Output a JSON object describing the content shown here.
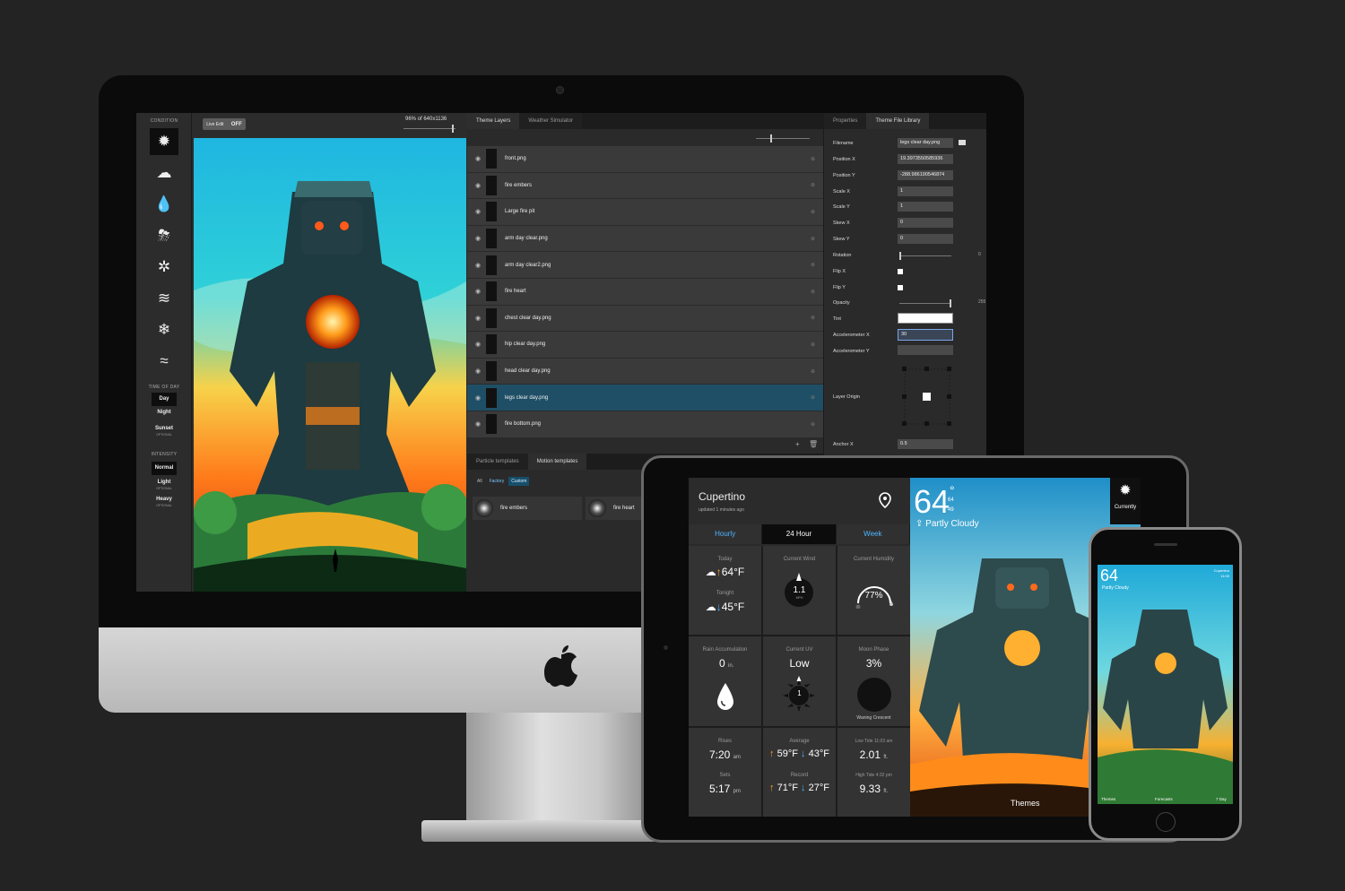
{
  "editor": {
    "condition_header": "CONDITION",
    "conditions": [
      {
        "icon": "sun-icon",
        "glyph": "✹",
        "selected": true
      },
      {
        "icon": "cloud-icon",
        "glyph": "☁",
        "selected": false
      },
      {
        "icon": "raindrop-icon",
        "glyph": "💧",
        "selected": false
      },
      {
        "icon": "thunder-cloud-icon",
        "glyph": "⛈",
        "selected": false
      },
      {
        "icon": "sun-cloud-icon",
        "glyph": "✲",
        "selected": false
      },
      {
        "icon": "fog-icon",
        "glyph": "≋",
        "selected": false
      },
      {
        "icon": "snowflake-icon",
        "glyph": "❄",
        "selected": false
      },
      {
        "icon": "wind-icon",
        "glyph": "≈",
        "selected": false
      }
    ],
    "time_header": "TIME OF DAY",
    "time_options": [
      {
        "label": "Day",
        "sub": "",
        "selected": true
      },
      {
        "label": "Night",
        "sub": "",
        "selected": false
      },
      {
        "label": "Sunset",
        "sub": "OPTIONAL",
        "selected": false
      }
    ],
    "intensity_header": "INTENSITY",
    "intensity_options": [
      {
        "label": "Normal",
        "sub": "",
        "selected": true
      },
      {
        "label": "Light",
        "sub": "OPTIONAL",
        "selected": false
      },
      {
        "label": "Heavy",
        "sub": "OPTIONAL",
        "selected": false
      }
    ],
    "live_edit_label": "Live Edit",
    "live_edit_state": "OFF",
    "zoom_text": "96% of 640x1136",
    "layer_tabs": [
      "Theme Layers",
      "Weather Simulator"
    ],
    "layers": [
      {
        "name": "front.png",
        "selected": false
      },
      {
        "name": "fire embers",
        "selected": false
      },
      {
        "name": "Large fire pit",
        "selected": false
      },
      {
        "name": "arm day clear.png",
        "selected": false
      },
      {
        "name": "arm day clear2.png",
        "selected": false
      },
      {
        "name": "fire heart",
        "selected": false
      },
      {
        "name": "chest clear day.png",
        "selected": false
      },
      {
        "name": "hip clear day.png",
        "selected": false
      },
      {
        "name": "head clear day.png",
        "selected": false
      },
      {
        "name": "legs clear day.png",
        "selected": true
      },
      {
        "name": "fire bottom.png",
        "selected": false
      }
    ],
    "particle_tabs": [
      "Particle templates",
      "Motion templates"
    ],
    "particle_filters": [
      "All",
      "Factory",
      "Custom"
    ],
    "particles": [
      "fire embers",
      "fire heart"
    ],
    "prop_tabs": [
      "Properties",
      "Theme File Library"
    ],
    "props": {
      "filename_label": "Filename",
      "filename": "legs clear day.png",
      "posx_label": "Position X",
      "posx": "19.3973550585936",
      "posy_label": "Position Y",
      "posy": "-288.986190546874",
      "scalex_label": "Scale X",
      "scalex": "1",
      "scaley_label": "Scale Y",
      "scaley": "1",
      "skewx_label": "Skew X",
      "skewx": "0",
      "skewy_label": "Skew Y",
      "skewy": "0",
      "rotation_label": "Rotation",
      "rotation": "0",
      "flipx_label": "Flip X",
      "flipy_label": "Flip Y",
      "opacity_label": "Opacity",
      "opacity": "255",
      "tint_label": "Tint",
      "accx_label": "Accelerometer X",
      "accx": "30",
      "accy_label": "Accelerometer Y",
      "accy": "",
      "origin_label": "Layer Origin",
      "anchorx_label": "Anchor X",
      "anchorx": "0.5"
    }
  },
  "ipad": {
    "city": "Cupertino",
    "updated": "updated 1 minutes ago",
    "tabs": [
      "Hourly",
      "24 Hour",
      "Week"
    ],
    "today_label": "Today",
    "today_temp": "64°F",
    "tonight_label": "Tonight",
    "tonight_temp": "45°F",
    "wind_label": "Current Wind",
    "wind_value": "1.1",
    "wind_unit": "MPH",
    "humidity_label": "Current Humidity",
    "humidity_value": "77%",
    "rain_label": "Rain Accumulation",
    "rain_value": "0",
    "rain_unit": "in.",
    "uv_label": "Current UV",
    "uv_value": "Low",
    "uv_index": "1",
    "moon_label": "Moon Phase",
    "moon_value": "3%",
    "moon_name": "Waning Crescent",
    "rises_label": "Rises",
    "rises_value": "7:20",
    "rises_unit": "am",
    "sets_label": "Sets",
    "sets_value": "5:17",
    "sets_unit": "pm",
    "avg_label": "Average",
    "avg_high": "59°F",
    "avg_low": "43°F",
    "record_label": "Record",
    "record_high": "71°F",
    "record_low": "27°F",
    "low_tide_label": "Low Tide 11:03 am",
    "low_tide_value": "2.01",
    "low_tide_unit": "ft.",
    "high_tide_label": "High Tide 4:32 pm",
    "high_tide_value": "9.33",
    "high_tide_unit": "ft.",
    "big_temp": "64",
    "temp_hi": "64",
    "temp_lo": "49",
    "condition": "Partly Cloudy",
    "currently": "Currently",
    "themes": "Themes"
  },
  "iphone": {
    "temp": "64",
    "condition": "Partly Cloudy",
    "city": "Cupertino",
    "time": "11:00",
    "bar": [
      "Themes",
      "Forecasts",
      "7 Day"
    ]
  },
  "colors": {
    "accent": "#4fb5ff",
    "selected_layer": "#1f4f66",
    "high": "#ff9e3a"
  }
}
